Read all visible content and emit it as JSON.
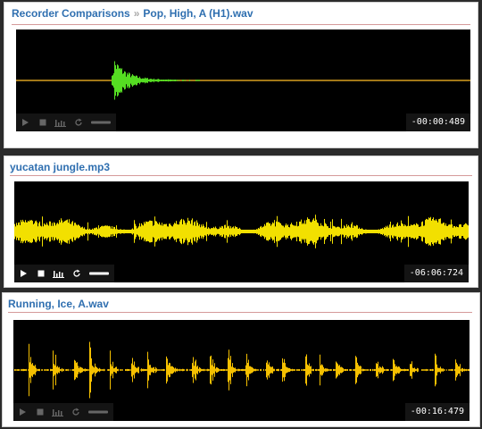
{
  "panels": [
    {
      "breadcrumb": "Recorder Comparisons",
      "breadcrumb_sep": "»",
      "title": "Pop, High, A (H1).wav",
      "timecode": "-00:00:489",
      "wave_color": "#55dd22",
      "line_color": "#d8a020"
    },
    {
      "title": "yucatan jungle.mp3",
      "timecode": "-06:06:724",
      "wave_color": "#f2e000"
    },
    {
      "title": "Running, Ice, A.wav",
      "timecode": "-00:16:479",
      "wave_color": "#f5c000"
    }
  ],
  "controls": {
    "icons": [
      "play-icon",
      "stop-icon",
      "waveform-icon",
      "loop-icon",
      "volume-slider"
    ]
  },
  "colors": {
    "link": "#2f6fb0",
    "rule": "#d59a9a",
    "player_bg": "#000000"
  }
}
